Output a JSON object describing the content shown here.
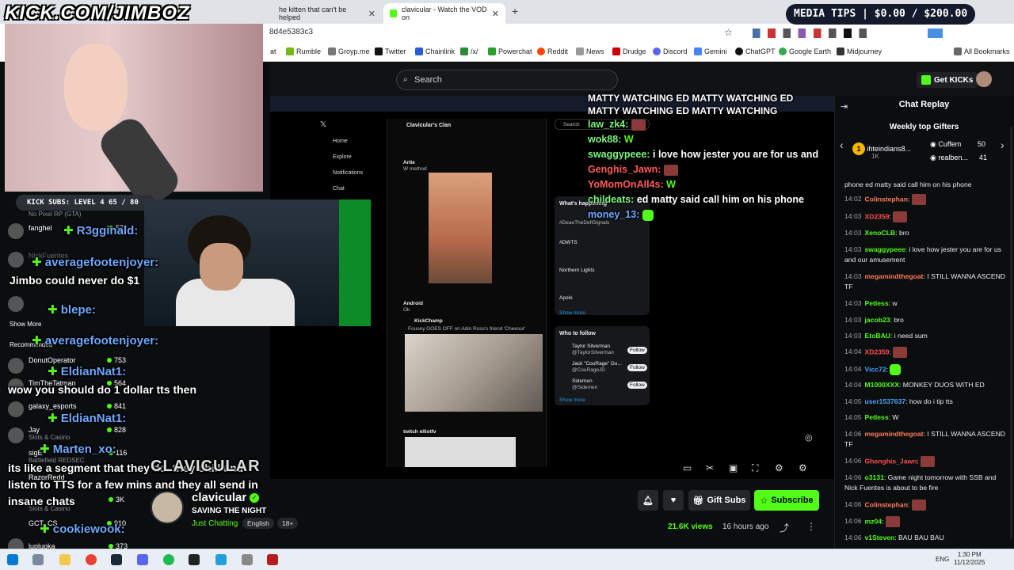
{
  "browser": {
    "tabs": [
      {
        "label": "he kitten that can't be helped"
      },
      {
        "label": "clavicular - Watch the VOD on"
      }
    ],
    "url": "8d4e5383c3",
    "bookmarks": [
      "at",
      "Rumble",
      "Groyp.me",
      "Twitter",
      "Chainlink",
      "/x/",
      "Powerchat",
      "Reddit",
      "News",
      "Drudge",
      "Discord",
      "Gemini",
      "ChatGPT",
      "Google Earth",
      "Midjourney"
    ],
    "all_bookmarks": "All Bookmarks"
  },
  "kick": {
    "search_placeholder": "Search",
    "get_kicks": "Get KICKs"
  },
  "player": {
    "overlay_chat": [
      {
        "user": "",
        "text": "MATTY WATCHING ED MATTY WATCHING ED MATTY WATCHING ED MATTY WATCHING",
        "cls": ""
      },
      {
        "user": "law_zk4:",
        "text": "",
        "cls": "r"
      },
      {
        "user": "wok88:",
        "text": "W",
        "cls": ""
      },
      {
        "user": "swaggypeee:",
        "text": "i love how jester you are for us and",
        "cls": ""
      },
      {
        "user": "Genghis_Jawn:",
        "text": "",
        "cls": "r"
      },
      {
        "user": "YoMomOnAll4s:",
        "text": "W",
        "cls": "r"
      },
      {
        "user": "childeats:",
        "text": "ed matty said call him on his phone",
        "cls": ""
      },
      {
        "user": "money_13:",
        "text": "",
        "cls": ""
      }
    ],
    "twitter": {
      "nav": [
        "Home",
        "Explore",
        "Notifications",
        "Chat"
      ],
      "clan": "Clavicular's Clan",
      "search": "Search",
      "post1_user": "Artie",
      "post1_text": "W method",
      "post2_user": "Android",
      "post2_text": "Ok",
      "quote_user": "KickChamp",
      "quote_text": "Fousey GOES OFF on Adin Ross's friend 'Cheesur'",
      "post3_user": "twitch elliotfv",
      "whats_happening": "What's happening",
      "trend1": "#DeaeTheDefiSignals",
      "trend2": "#DWTS",
      "trend3": "Northern Lights",
      "trend4": "Apolo",
      "show_more": "Show more",
      "who_to_follow": "Who to follow",
      "follow": [
        {
          "name": "Taylor Silverman",
          "handle": "@TaylorSilverman"
        },
        {
          "name": "Jack \"CouRage\" Du...",
          "handle": "@CouRageJD"
        },
        {
          "name": "Sidemen",
          "handle": "@Sidemen"
        }
      ],
      "follow_btn": "Follow",
      "show_more2": "Show more"
    }
  },
  "stream": {
    "channel": "clavicular",
    "title": "SAVING THE NIGHT",
    "category": "Just Chatting",
    "tags": [
      "English",
      "18+"
    ],
    "views": "21.6K views",
    "ago": "16 hours ago",
    "gift_subs": "Gift Subs",
    "subscribe": "Subscribe"
  },
  "chat": {
    "header": "Chat Replay",
    "weekly_top": "Weekly top Gifters",
    "gifters": [
      {
        "name": "ihteindians8...",
        "count": "1K",
        "rank": "1"
      },
      {
        "name": "Cuffem",
        "count": "50"
      },
      {
        "name": "realben...",
        "count": "41"
      }
    ],
    "messages": [
      {
        "time": "",
        "user": "",
        "color": "#e8eaed",
        "text": "phone ed matty said call him on his phone",
        "emote": ""
      },
      {
        "time": "14:02",
        "user": "Colinstephan",
        "color": "#ff7a5c",
        "text": "",
        "emote": "r"
      },
      {
        "time": "14:03",
        "user": "XD2359",
        "color": "#ff4d4d",
        "text": "",
        "emote": "r"
      },
      {
        "time": "14:03",
        "user": "XenoCLB",
        "color": "#53fc18",
        "text": "bro",
        "emote": ""
      },
      {
        "time": "14:03",
        "user": "swaggypeee",
        "color": "#53fc18",
        "text": "i love how jester you are for us and our amusement",
        "emote": ""
      },
      {
        "time": "14:03",
        "user": "megamindthegoat",
        "color": "#ff7a5c",
        "text": "I STILL WANNA ASCEND TF",
        "emote": ""
      },
      {
        "time": "14:03",
        "user": "Petless",
        "color": "#53fc18",
        "text": "w",
        "emote": ""
      },
      {
        "time": "14:03",
        "user": "jacob23",
        "color": "#53fc18",
        "text": "bro",
        "emote": ""
      },
      {
        "time": "14:03",
        "user": "EtoBAU",
        "color": "#53fc18",
        "text": "i need sum",
        "emote": ""
      },
      {
        "time": "14:04",
        "user": "XD2359",
        "color": "#ff4d4d",
        "text": "",
        "emote": "r"
      },
      {
        "time": "14:04",
        "user": "Vicc72",
        "color": "#4da3ff",
        "text": "",
        "emote": "g"
      },
      {
        "time": "14:04",
        "user": "M1000XXX",
        "color": "#53fc18",
        "text": "MONKEY DUOS WITH ED",
        "emote": ""
      },
      {
        "time": "14:05",
        "user": "user1537637",
        "color": "#4da3ff",
        "text": "how do i tip tts",
        "emote": ""
      },
      {
        "time": "14:05",
        "user": "Petless",
        "color": "#53fc18",
        "text": "W",
        "emote": ""
      },
      {
        "time": "14:06",
        "user": "megamindthegoat",
        "color": "#ff7a5c",
        "text": "I STILL WANNA ASCEND TF",
        "emote": ""
      },
      {
        "time": "14:06",
        "user": "Ghenghis_Jawn",
        "color": "#ff4d4d",
        "text": "",
        "emote": "r"
      },
      {
        "time": "14:06",
        "user": "o3131",
        "color": "#53fc18",
        "text": "Game night tomorrow with SSB and Nick Fuentes is about to be fire",
        "emote": ""
      },
      {
        "time": "14:06",
        "user": "Colinstephan",
        "color": "#ff7a5c",
        "text": "",
        "emote": "r"
      },
      {
        "time": "14:06",
        "user": "mz04",
        "color": "#53fc18",
        "text": "",
        "emote": "r"
      },
      {
        "time": "14:06",
        "user": "v1Steven",
        "color": "#53fc18",
        "text": "BAU BAU BAU",
        "emote": ""
      }
    ]
  },
  "overlay": {
    "brand": "KICK.COM/JIMBOZ",
    "media_tips": "MEDIA TIPS | $0.00 / $200.00",
    "subs_bar": "KICK SUBS: LEVEL 4 65 / 80",
    "chat_lines": [
      {
        "user": "R3gginald:",
        "text": ""
      },
      {
        "user": "averagefootenjoyer:",
        "text": ""
      },
      {
        "user": "",
        "text": "Jimbo could never do $1"
      },
      {
        "user": "blepe:",
        "text": ""
      },
      {
        "user": "averagefootenjoyer:",
        "text": ""
      },
      {
        "user": "EldianNat1:",
        "text": ""
      },
      {
        "user": "",
        "text": "wow you should do 1 dollar tts then"
      },
      {
        "user": "EldianNat1:",
        "text": ""
      },
      {
        "user": "Marten_xo:",
        "text": ""
      },
      {
        "user": "",
        "text": "its like a segment that they do. they chill and"
      },
      {
        "user": "",
        "text": "listen to TTS for a few mins and they all send in"
      },
      {
        "user": "",
        "text": "insane chats"
      },
      {
        "user": "cookiewook:",
        "text": ""
      }
    ],
    "bottom_banner": "CLAVICULAR"
  },
  "sidebar": {
    "items": [
      {
        "name": "No Pixel RP (GTA)",
        "cat": "",
        "count": ""
      },
      {
        "name": "fanghel",
        "cat": "",
        "count": "572"
      },
      {
        "name": "NickFuentes",
        "cat": "",
        "count": ""
      },
      {
        "name": "Show More",
        "cat": "",
        "count": ""
      },
      {
        "name": "Recommended",
        "cat": "",
        "count": ""
      },
      {
        "name": "DonutOperator",
        "cat": "",
        "count": "753"
      },
      {
        "name": "TimTheTatman",
        "cat": "",
        "count": "564"
      },
      {
        "name": "galaxy_esports",
        "cat": "",
        "count": "841"
      },
      {
        "name": "Jay",
        "cat": "Slots & Casino",
        "count": "828"
      },
      {
        "name": "sigE",
        "cat": "Battlefield REDSEC",
        "count": "116"
      },
      {
        "name": "RazorRedd",
        "cat": "",
        "count": ""
      },
      {
        "name": "",
        "cat": "Slots & Casino",
        "count": "3K"
      },
      {
        "name": "GCT_CS",
        "cat": "",
        "count": "910"
      },
      {
        "name": "luplupka",
        "cat": "",
        "count": "373"
      }
    ]
  },
  "taskbar": {
    "lang": "ENG",
    "time": "1:30 PM",
    "date": "11/12/2025"
  },
  "colors": {
    "kick_green": "#53fc18",
    "bg": "#0b0e0f"
  }
}
